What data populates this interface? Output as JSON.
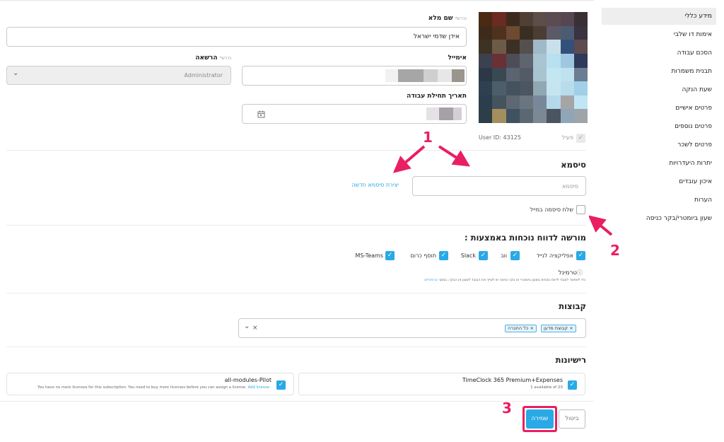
{
  "sidebar": {
    "items": [
      {
        "label": "מידע כללי",
        "active": true
      },
      {
        "label": "אימות דו שלבי"
      },
      {
        "label": "הסכם עבודה"
      },
      {
        "label": "תבנית משמרות"
      },
      {
        "label": "שעת הנקה"
      },
      {
        "label": "פרטים אישיים"
      },
      {
        "label": "פרטים נוספים"
      },
      {
        "label": "פרטים לשכר"
      },
      {
        "label": "יתרות היעדרויות"
      },
      {
        "label": "איכון עובדים"
      },
      {
        "label": "הערות"
      },
      {
        "label": "שעון ביומטרי/בקר כניסה"
      }
    ]
  },
  "general": {
    "full_name_label": "שם מלא",
    "required_mark": "נדרש*",
    "full_name_value": "אידן שדמי ישראל",
    "email_label": "אימייל",
    "permission_label": "הרשאה",
    "permission_value": "Administrator",
    "start_date_label": "תאריך תחילת עבודה",
    "active_label": "פעיל",
    "user_id": "User ID: 43125"
  },
  "password": {
    "title": "סיסמא",
    "placeholder": "סיסמא",
    "create_link": "יצירת סיסמא חדשה",
    "send_email_label": "שלח סיסמה במייל"
  },
  "attendance": {
    "title": ": מורשה לדווח נוכחות באמצעות",
    "options": [
      {
        "label": "אפליקציה לנייד",
        "checked": true
      },
      {
        "label": "ווב",
        "checked": true
      },
      {
        "label": "Slack",
        "checked": true
      },
      {
        "label": "תוסף כרום",
        "checked": true
      },
      {
        "label": "MS-Teams",
        "checked": true
      }
    ],
    "terminal_label": "טרמינל",
    "terminal_note": "כדי לאפשר לעובד לדווח נוכחות בשעון ביומטרי או בקר כניסה יש לשייך את העובד לשעון או הבקר, במסך",
    "terminal_link": "טרמינלים"
  },
  "groups": {
    "title": "קבוצות",
    "tags": [
      "קבוצת מדען",
      "כל החברה"
    ],
    "clear_symbol": "×",
    "tag_remove_symbol": "×"
  },
  "licenses": {
    "title": "רישיונות",
    "items": [
      {
        "name": "TimeClock 365 Premium+Expenses",
        "detail": "1 available of 20",
        "checked": true
      },
      {
        "name": "all-modules-Pilot",
        "detail": "You have no more licenses for this subscription. You need to buy more licenses before you can assign a license.",
        "link": "Add license",
        "checked": true
      }
    ]
  },
  "actions": {
    "save_label": "שמירה",
    "cancel_label": "ביטול"
  },
  "annotations": {
    "n1": "1",
    "n2": "2",
    "n3": "3",
    "color": "#e91e63"
  },
  "icons": {
    "check": "✓",
    "chevron": "⌄",
    "calendar": "calendar-icon",
    "info": "ⓘ"
  }
}
